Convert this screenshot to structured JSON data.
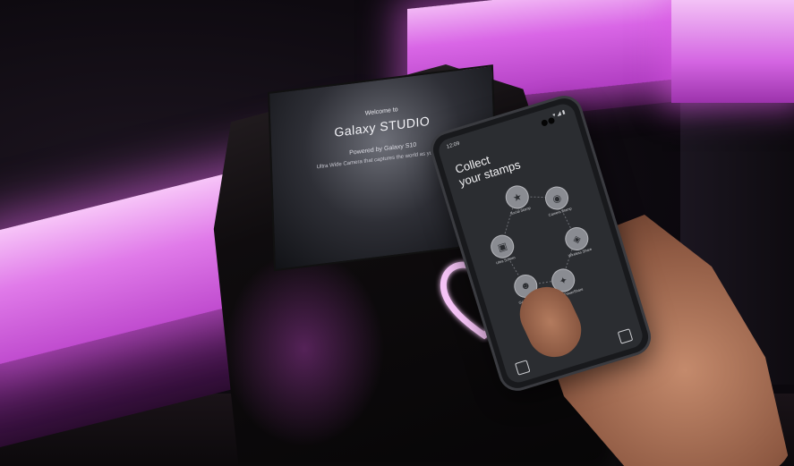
{
  "kiosk_screen": {
    "welcome": "Welcome to",
    "brand": "Galaxy STUDIO",
    "powered": "Powered by Galaxy S10",
    "tagline": "Ultra Wide Camera that captures the world as you see it"
  },
  "phone": {
    "status_time": "12:09",
    "status_icons": "▾ ◢ ▮",
    "title_line1": "Collect",
    "title_line2": "your stamps",
    "stamps": [
      {
        "icon": "★",
        "label": "Social Stamp"
      },
      {
        "icon": "◉",
        "label": "Camera Stamp"
      },
      {
        "icon": "▣",
        "label": "Ultra Screen"
      },
      {
        "icon": "◈",
        "label": "Wireless Share"
      },
      {
        "icon": "☻",
        "label": "Game Stamp"
      },
      {
        "icon": "✦",
        "label": "Wireless PowerShare"
      }
    ]
  },
  "colors": {
    "neon": "#e07ae9",
    "kiosk": "#0f0c0e",
    "heart": "#f6c4f7"
  }
}
